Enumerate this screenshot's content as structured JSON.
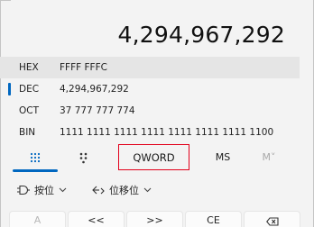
{
  "display": {
    "value": "4,294,967,292"
  },
  "radix": [
    {
      "name": "HEX",
      "value": "FFFF FFFC"
    },
    {
      "name": "DEC",
      "value": "4,294,967,292"
    },
    {
      "name": "OCT",
      "value": "37 777 777 774"
    },
    {
      "name": "BIN",
      "value": "1111 1111 1111 1111 1111 1111 1111 1100"
    }
  ],
  "selected_radix": "DEC",
  "tabs": {
    "keypad_icon": "keypad-grid-icon",
    "bits_icon": "bit-toggle-icon",
    "word_size": "QWORD",
    "memory_store": "MS",
    "memory_view": "M˅"
  },
  "ops": {
    "bitwise_label": "按位",
    "bitwise_icon": "bitwise-gate-icon",
    "shift_label": "位移位",
    "shift_icon": "bit-shift-icon"
  },
  "keys": {
    "a": "A",
    "left_shift": "<<",
    "right_shift": ">>",
    "clear_entry": "CE",
    "backspace_icon": "backspace-icon"
  },
  "colors": {
    "accent": "#0067c0",
    "highlight_outline": "#e2001a",
    "selected_row_bg": "#e5e5e5"
  }
}
